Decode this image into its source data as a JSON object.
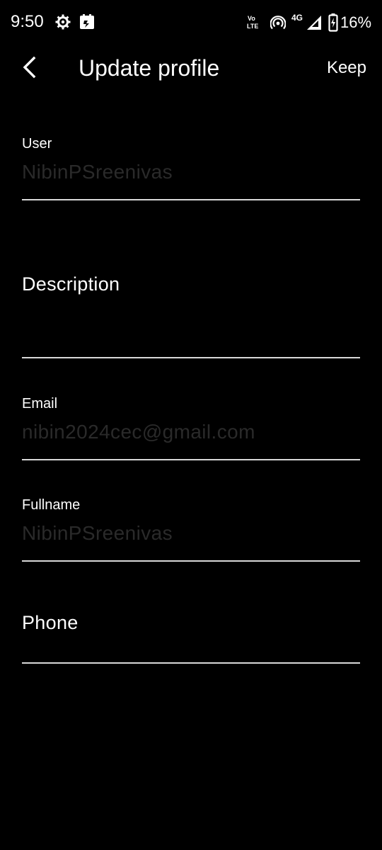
{
  "status_bar": {
    "time": "9:50",
    "network_type": "4G",
    "volte_top": "Vo",
    "volte_bottom": "LTE",
    "battery": "16%",
    "icons": [
      "settings-gear-icon",
      "notification-app-icon",
      "volte-icon",
      "hotspot-icon",
      "signal-icon",
      "battery-charging-icon"
    ]
  },
  "app_bar": {
    "title": "Update profile",
    "action": "Keep",
    "back_icon": "chevron-left-icon"
  },
  "form": {
    "user": {
      "label": "User",
      "value": "NibinPSreenivas"
    },
    "description": {
      "label": "Description",
      "value": ""
    },
    "email": {
      "label": "Email",
      "value": "nibin2024cec@gmail.com"
    },
    "fullname": {
      "label": "Fullname",
      "value": "NibinPSreenivas"
    },
    "phone": {
      "label": "Phone",
      "value": ""
    }
  },
  "colors": {
    "background": "#000000",
    "text": "#ffffff",
    "value_text": "#2a2a2a",
    "underline": "#d9d9d9"
  }
}
